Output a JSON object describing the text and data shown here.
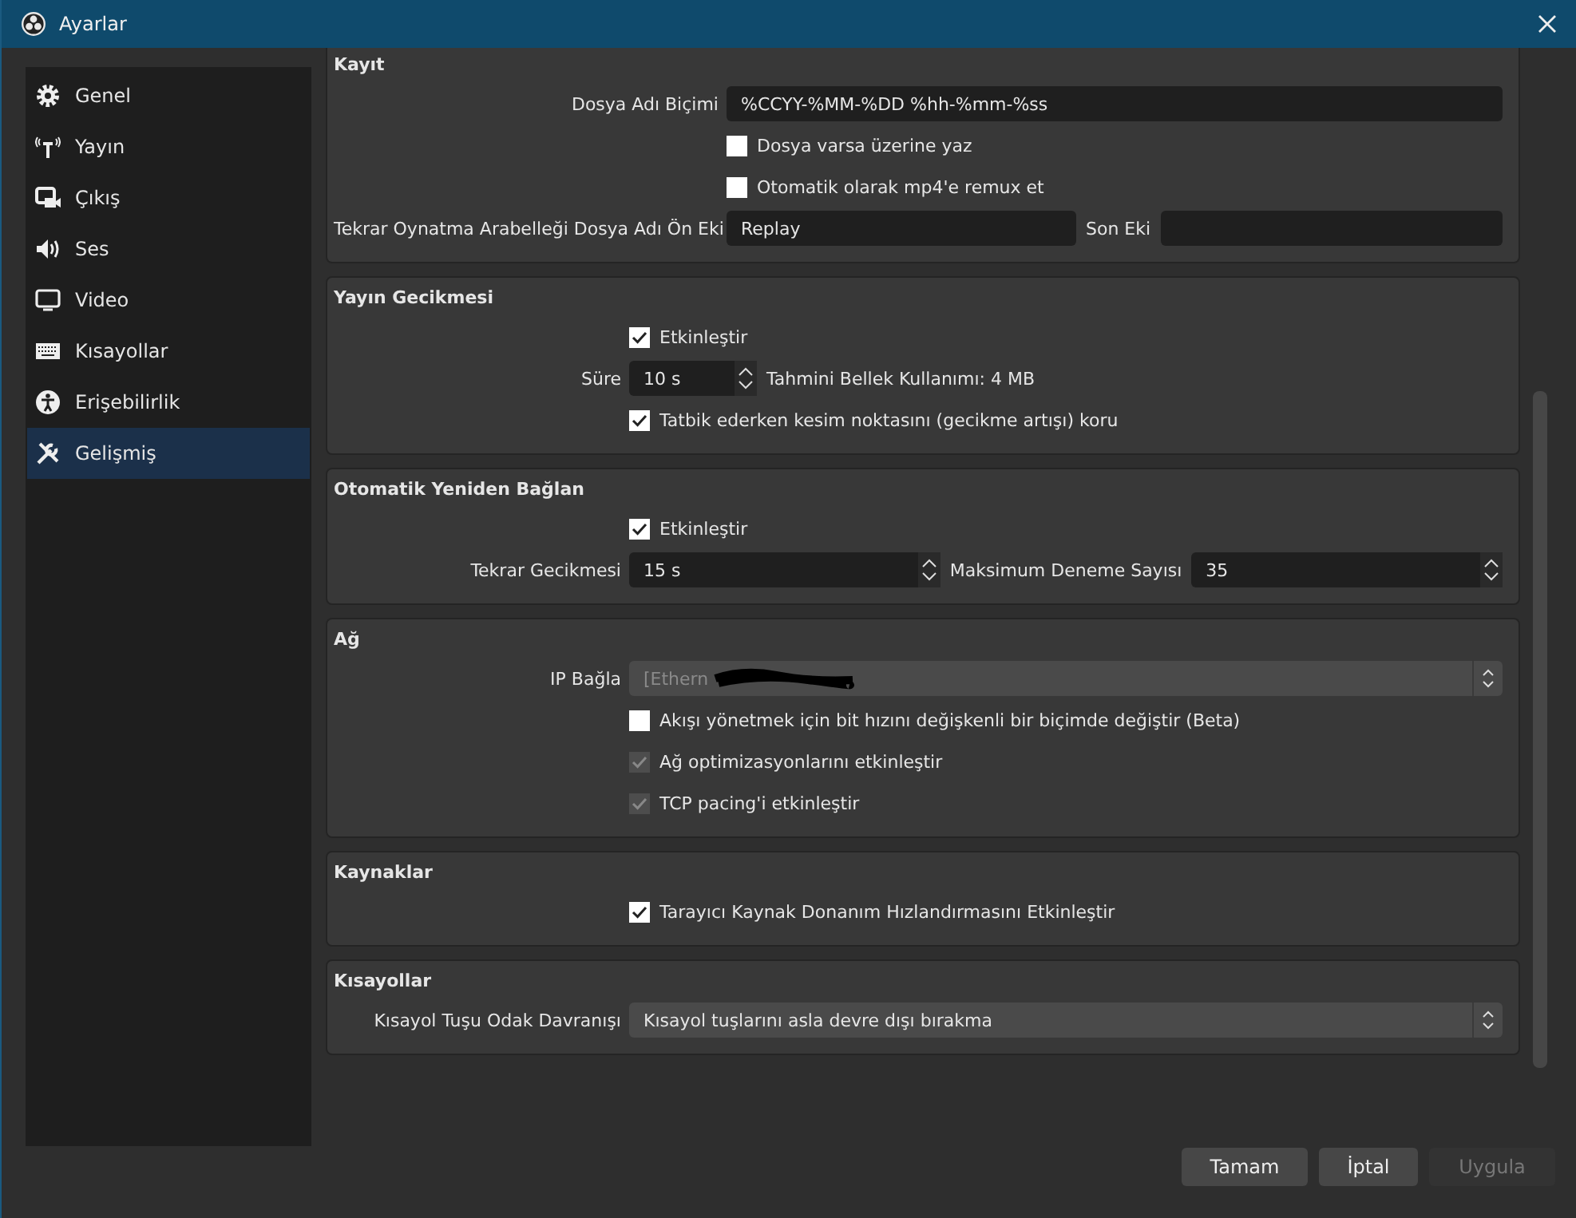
{
  "window": {
    "title": "Ayarlar"
  },
  "sidebar": {
    "items": [
      {
        "label": "Genel",
        "selected": false
      },
      {
        "label": "Yayın",
        "selected": false
      },
      {
        "label": "Çıkış",
        "selected": false
      },
      {
        "label": "Ses",
        "selected": false
      },
      {
        "label": "Video",
        "selected": false
      },
      {
        "label": "Kısayollar",
        "selected": false
      },
      {
        "label": "Erişebilirlik",
        "selected": false
      },
      {
        "label": "Gelişmiş",
        "selected": true
      }
    ]
  },
  "groups": [
    {
      "title": "Kayıt",
      "rows": [
        {
          "kind": "text",
          "label": "Dosya Adı Biçimi",
          "value": "%CCYY-%MM-%DD %hh-%mm-%ss"
        },
        {
          "kind": "checkbox",
          "label": "Dosya varsa üzerine yaz",
          "checked": false,
          "disabled": false
        },
        {
          "kind": "checkbox",
          "label": "Otomatik olarak mp4'e remux et",
          "checked": false,
          "disabled": false
        },
        {
          "kind": "pair",
          "label": "Tekrar Oynatma Arabelleği Dosya Adı Ön Eki",
          "value": "Replay",
          "label2": "Son Eki",
          "value2": ""
        }
      ]
    },
    {
      "title": "Yayın Gecikmesi",
      "rows": [
        {
          "kind": "checkbox",
          "label": "Etkinleştir",
          "checked": true,
          "disabled": false
        },
        {
          "kind": "spin",
          "label": "Süre",
          "value": "10 s",
          "note": "Tahmini Bellek Kullanımı: 4 MB"
        },
        {
          "kind": "checkbox",
          "label": "Tatbik ederken kesim noktasını (gecikme artışı) koru",
          "checked": true,
          "disabled": false
        }
      ]
    },
    {
      "title": "Otomatik Yeniden Bağlan",
      "rows": [
        {
          "kind": "checkbox",
          "label": "Etkinleştir",
          "checked": true,
          "disabled": false
        },
        {
          "kind": "spin2",
          "label": "Tekrar Gecikmesi",
          "value": "15 s",
          "label2": "Maksimum Deneme Sayısı",
          "value2": "35"
        }
      ]
    },
    {
      "title": "Ağ",
      "rows": [
        {
          "kind": "select",
          "label": "IP Bağla",
          "value": "[Ethern",
          "disabled": true,
          "redacted": true
        },
        {
          "kind": "checkbox",
          "label": "Akışı yönetmek için bit hızını değişkenli bir biçimde değiştir (Beta)",
          "checked": false,
          "disabled": false
        },
        {
          "kind": "checkbox",
          "label": "Ağ optimizasyonlarını etkinleştir",
          "checked": true,
          "disabled": true
        },
        {
          "kind": "checkbox",
          "label": "TCP pacing'i etkinleştir",
          "checked": true,
          "disabled": true
        }
      ]
    },
    {
      "title": "Kaynaklar",
      "rows": [
        {
          "kind": "checkbox",
          "label": "Tarayıcı Kaynak Donanım Hızlandırmasını Etkinleştir",
          "checked": true,
          "disabled": false
        }
      ]
    },
    {
      "title": "Kısayollar",
      "rows": [
        {
          "kind": "select",
          "label": "Kısayol Tuşu Odak Davranışı",
          "value": "Kısayol tuşlarını asla devre dışı bırakma",
          "disabled": false,
          "redacted": false
        }
      ]
    }
  ],
  "buttons": [
    {
      "label": "Tamam",
      "disabled": false
    },
    {
      "label": "İptal",
      "disabled": false
    },
    {
      "label": "Uygula",
      "disabled": true
    }
  ]
}
